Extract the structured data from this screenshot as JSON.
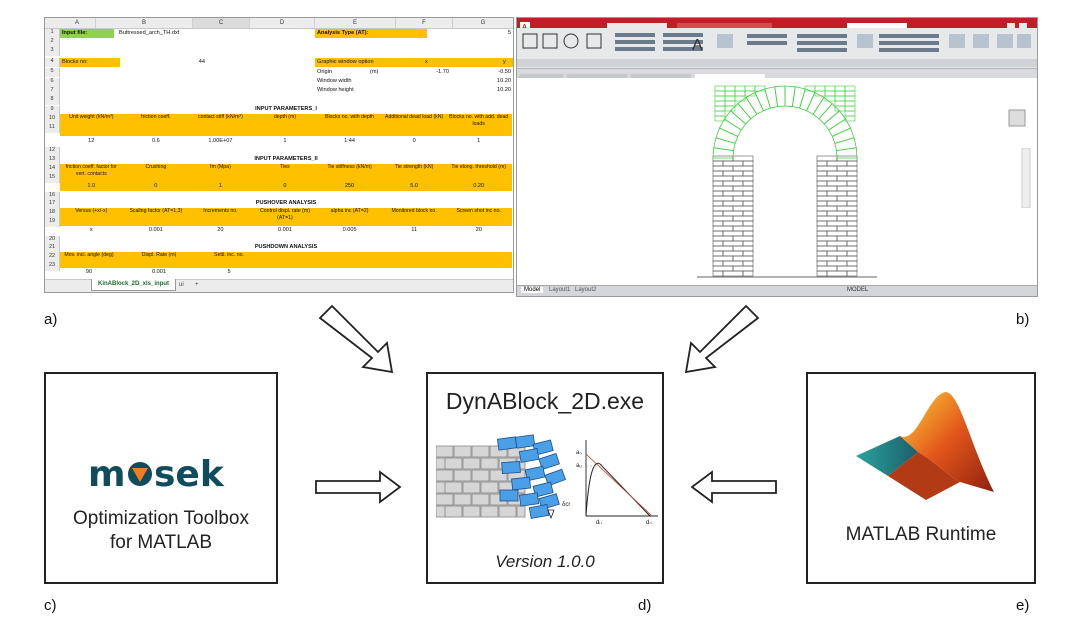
{
  "panel_labels": {
    "a": "a)",
    "b": "b)",
    "c": "c)",
    "d": "d)",
    "e": "e)"
  },
  "spreadsheet": {
    "columns": [
      "A",
      "B",
      "C",
      "D",
      "E",
      "F",
      "G"
    ],
    "rows": [
      "1",
      "2",
      "3",
      "4",
      "5",
      "6",
      "7",
      "8",
      "9",
      "10",
      "11",
      "12",
      "13",
      "14",
      "15",
      "16",
      "17",
      "18",
      "19",
      "20",
      "21",
      "22",
      "23"
    ],
    "input_file_label": "Input file:",
    "input_file_value": "Buttressed_arch_TH.dxf",
    "analysis_type_label": "Analysis Type (AT):",
    "analysis_type_value": "5",
    "blocks_no_label": "Blocks no:",
    "blocks_no_value": "44",
    "graphic_window_label": "Graphic window option",
    "gw_x": "x",
    "gw_y": "y",
    "origin_label": "Origin",
    "origin_unit": "(m)",
    "origin_x": "-1.70",
    "origin_y": "-0.50",
    "window_width_label": "Window width",
    "window_width_value": "10.20",
    "window_height_label": "Window height",
    "window_height_value": "10.20",
    "section1": "INPUT PARAMETERS_I",
    "p1_headers": [
      "Unit weight  (kN/m³)",
      "friction coeff.",
      "contact stiff (kN/m³)",
      "depth (m)",
      "Blocks no. with depth",
      "Additional dead load   (kN)",
      "Blocks no. with add. dead loads"
    ],
    "p1_values": [
      "12",
      "0.6",
      "1.00E+07",
      "1",
      "1:44",
      "0",
      "1"
    ],
    "section2": "INPUT PARAMETERS_II",
    "p2_headers": [
      "friction coeff. factor for vert. contacts",
      "Crushing",
      "fm (Mpa)",
      "Ties",
      "Tie stiffness (kN/m)",
      "Tie strength   (kN)",
      "Tie elong. threshold (m)"
    ],
    "p2_values": [
      "1.0",
      "0",
      "1",
      "0",
      "250",
      "5.0",
      "0.20"
    ],
    "section3": "PUSHOVER ANALYSIS",
    "p3_headers": [
      "Versus   (+x/-x)",
      "Scaling factor (AT=1,3)",
      "Increments no.",
      "Control displ. rate (m) (AT=1)",
      "alpha inc (AT=2)",
      "Monitored block no.",
      "Screen shot inc no."
    ],
    "p3_values": [
      "x",
      "0.001",
      "20",
      "0.001",
      "0.005",
      "11",
      "20"
    ],
    "section4": "PUSHDOWN ANALYSIS",
    "p4_headers": [
      "Mov. incl. angle (deg)",
      "Displ. Rate       (m)",
      "Settl. inc. no."
    ],
    "p4_values": [
      "90",
      "0.001",
      "5"
    ],
    "sheet_tab": "KinABlock_2D_xls_input",
    "sheet_tab2": "ui",
    "sheet_add": "+"
  },
  "cad": {
    "tab_model": "Model",
    "tab_layout1": "Layout1",
    "tab_layout2": "Layout2",
    "status_text": "MODEL",
    "colors": {
      "title": "#c11f26",
      "ribbon": "#e6e8ea",
      "green_blocks": "#3fd13f",
      "blocks": "#555555"
    },
    "icons": [
      "autocad-logo-icon",
      "viewcube-icon",
      "navbar-icon"
    ]
  },
  "mosek": {
    "logo": "mosek",
    "caption_line1": "Optimization Toolbox",
    "caption_line2": "for MATLAB"
  },
  "dynablock": {
    "title": "DynABlock_2D.exe",
    "version": "Version 1.0.0",
    "graph_labels": {
      "a0": "a₀",
      "aw": "aᵤ",
      "dcr": "δcr",
      "du": "dᵤ",
      "d0": "d₀"
    }
  },
  "matlab": {
    "caption": "MATLAB Runtime",
    "icon": "matlab-membrane-logo-icon"
  },
  "arrows": [
    "arrow-a-to-d",
    "arrow-b-to-d",
    "arrow-c-to-d",
    "arrow-e-to-d"
  ]
}
